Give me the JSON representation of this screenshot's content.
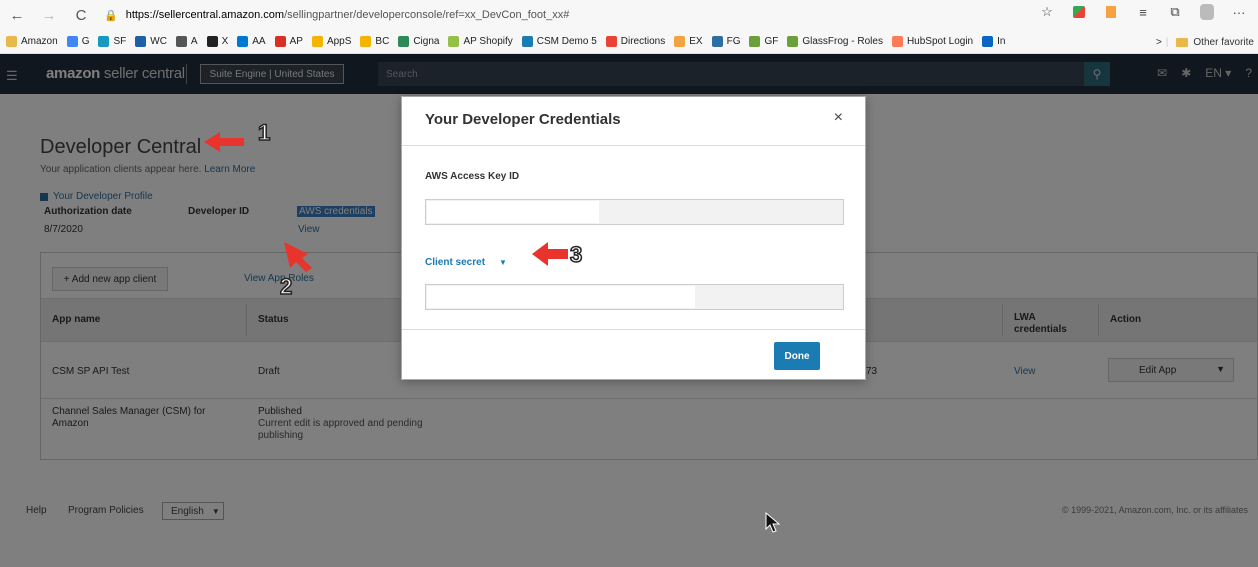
{
  "browser": {
    "back": "←",
    "forward": "→",
    "reload": "C",
    "url_host": "https://sellercentral.amazon.com",
    "url_path": "/sellingpartner/developerconsole/ref=xx_DevCon_foot_xx#",
    "bookmarks": [
      {
        "label": "Amazon",
        "color": "#e8b94a"
      },
      {
        "label": "G",
        "color": "#4285f4"
      },
      {
        "label": "SF",
        "color": "#1798c1"
      },
      {
        "label": "WC",
        "color": "#1f5ea8"
      },
      {
        "label": "A",
        "color": "#555555"
      },
      {
        "label": "X",
        "color": "#222222"
      },
      {
        "label": "AA",
        "color": "#0078d2"
      },
      {
        "label": "AP",
        "color": "#d93025"
      },
      {
        "label": "AppS",
        "color": "#f4b400"
      },
      {
        "label": "BC",
        "color": "#f4b400"
      },
      {
        "label": "Cigna",
        "color": "#2e8b57"
      },
      {
        "label": "AP Shopify",
        "color": "#95bf47"
      },
      {
        "label": "CSM Demo 5",
        "color": "#1b7bb3"
      },
      {
        "label": "Directions",
        "color": "#ea4335"
      },
      {
        "label": "EX",
        "color": "#f4a340"
      },
      {
        "label": "FG",
        "color": "#2c6fa0"
      },
      {
        "label": "GF",
        "color": "#6a9f3a"
      },
      {
        "label": "GlassFrog - Roles",
        "color": "#6a9f3a"
      },
      {
        "label": "HubSpot Login",
        "color": "#ff7a59"
      },
      {
        "label": "In",
        "color": "#0a66c2"
      }
    ],
    "other_favorites": "Other favorite",
    "chevron": ">"
  },
  "header": {
    "logo_main": "amazon",
    "logo_sub": " seller central",
    "store": "Suite Engine | United States",
    "search_placeholder": "Search",
    "lang": "EN ▾"
  },
  "page": {
    "title": "Developer Central",
    "subtitle": "Your application clients appear here.",
    "learn_more": "Learn More",
    "profile_link": "Your Developer Profile",
    "auth_date_label": "Authorization date",
    "auth_date": "8/7/2020",
    "dev_id_label": "Developer ID",
    "aws_cred_label": "AWS credentials",
    "aws_view": "View"
  },
  "apps": {
    "add_button": "+ Add new app client",
    "view_roles": "View App Roles",
    "columns": [
      "App name",
      "Status",
      "LWA credentials",
      "Action"
    ],
    "rows": [
      {
        "name": "CSM SP API Test",
        "status": "Draft",
        "lwa": "View",
        "action": "Edit App",
        "id_fragment": "73"
      },
      {
        "name": "Channel Sales Manager (CSM) for Amazon",
        "status": "Published",
        "status_note": "Current edit is approved and pending publishing"
      }
    ]
  },
  "footer": {
    "help": "Help",
    "policies": "Program Policies",
    "language": "English",
    "copyright": "© 1999-2021, Amazon.com, Inc. or its affiliates"
  },
  "modal": {
    "title": "Your Developer Credentials",
    "close": "×",
    "access_key_label": "AWS Access Key ID",
    "client_secret_label": "Client secret",
    "secret_toggle": "▼",
    "done": "Done"
  },
  "annotations": [
    "1",
    "2",
    "3"
  ]
}
